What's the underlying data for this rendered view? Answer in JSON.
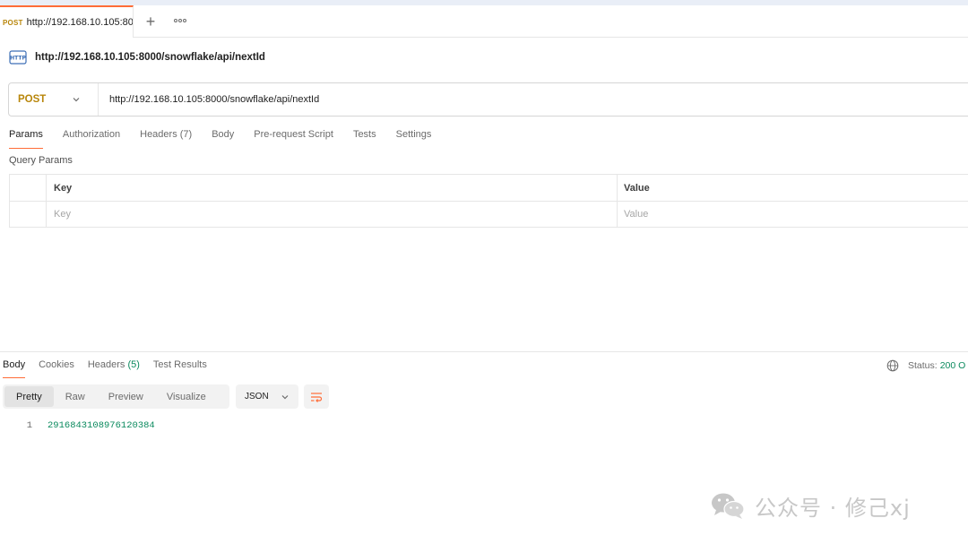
{
  "tab": {
    "method": "POST",
    "url": "http://192.168.10.105:8000/snowflake/api/nextId"
  },
  "toolbar": {
    "add_icon": "plus-icon",
    "more_icon": "more-options-icon"
  },
  "request": {
    "name": "http://192.168.10.105:8000/snowflake/api/nextId",
    "method": "POST",
    "url": "http://192.168.10.105:8000/snowflake/api/nextId",
    "tabs": [
      "Params",
      "Authorization",
      "Headers (7)",
      "Body",
      "Pre-request Script",
      "Tests",
      "Settings"
    ],
    "active_tab": "Params"
  },
  "params": {
    "label": "Query Params",
    "headers": {
      "key": "Key",
      "value": "Value"
    },
    "placeholder": {
      "key": "Key",
      "value": "Value"
    }
  },
  "response": {
    "tabs": {
      "body": "Body",
      "cookies": "Cookies",
      "headers_label": "Headers",
      "headers_count": "(5)",
      "test_results": "Test Results"
    },
    "status_label": "Status:",
    "status_value": "200 O",
    "views": [
      "Pretty",
      "Raw",
      "Preview",
      "Visualize"
    ],
    "active_view": "Pretty",
    "format": "JSON",
    "lines": [
      {
        "num": "1",
        "text": "2916843108976120384"
      }
    ]
  },
  "watermark": {
    "text": "公众号 · 修己xj"
  },
  "colors": {
    "accent": "#ff6c37",
    "method": "#b8860b",
    "success": "#0b8a5e"
  }
}
